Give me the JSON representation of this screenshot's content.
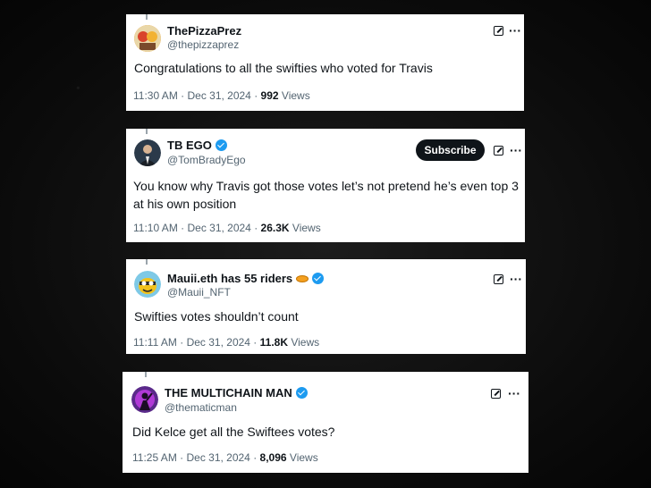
{
  "tweets": [
    {
      "name": "ThePizzaPrez",
      "handle": "@thepizzaprez",
      "verified": false,
      "text": "Congratulations to all the swifties who voted for Travis",
      "time": "11:30 AM · Dec 31, 2024 · ",
      "views": "992",
      "views_label": "Views",
      "avatar_icon": "pizza-avatar",
      "menu": "···"
    },
    {
      "name": "TB EGO",
      "handle": "@TomBradyEgo",
      "verified": true,
      "subscribe": "Subscribe",
      "text": "You know why Travis got those votes let’s not pretend he’s even top 3 at his own position",
      "time": "11:10 AM · Dec 31, 2024 · ",
      "views": "26.3K",
      "views_label": "Views",
      "avatar_icon": "suited-man-avatar",
      "menu": "···"
    },
    {
      "name": "Mauii.eth has 55 riders",
      "handle": "@Mauii_NFT",
      "verified": true,
      "text": "Swifties votes shouldn’t count",
      "time": "11:11 AM · Dec 31, 2024 · ",
      "views": "11.8K",
      "views_label": "Views",
      "avatar_icon": "cartoon-bee-avatar",
      "menu": "···"
    },
    {
      "name": "THE MULTICHAIN MAN",
      "handle": "@thematicman",
      "verified": true,
      "text": "Did Kelce get all the Swiftees votes?",
      "time": "11:25 AM · Dec 31, 2024 · ",
      "views": "8,096",
      "views_label": "Views",
      "avatar_icon": "purple-silhouette-avatar",
      "menu": "···"
    }
  ],
  "colors": {
    "verified_blue": "#1d9bf0",
    "text_primary": "#0f1419",
    "text_secondary": "#536471"
  }
}
